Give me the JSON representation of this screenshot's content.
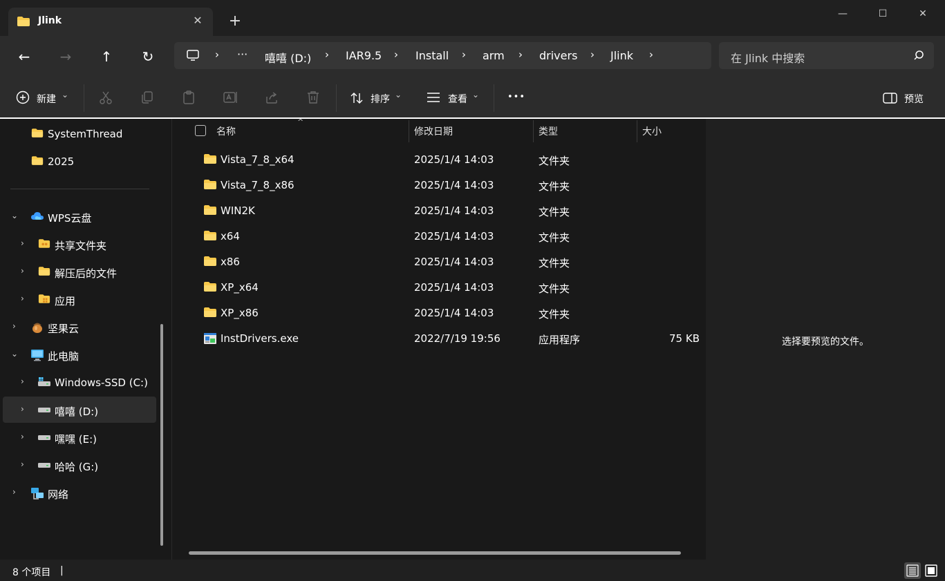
{
  "tab": {
    "title": "Jlink",
    "close": "✕"
  },
  "window": {
    "new_tab": "+",
    "minimize": "—",
    "maximize": "☐",
    "close": "✕"
  },
  "nav": {
    "back": "←",
    "forward": "→",
    "up": "↑",
    "refresh": "↻"
  },
  "breadcrumb": {
    "more": "···",
    "items": [
      "嘻嘻 (D:)",
      "IAR9.5",
      "Install",
      "arm",
      "drivers",
      "Jlink"
    ],
    "chevron": "›"
  },
  "search": {
    "placeholder": "在 Jlink 中搜索"
  },
  "toolbar": {
    "new_label": "新建",
    "sort_label": "排序",
    "view_label": "查看",
    "more_label": "•••",
    "preview_label": "预览",
    "dropdown": "⌄"
  },
  "sidebar": {
    "items": [
      {
        "label": "SystemThread",
        "icon": "folder-icon"
      },
      {
        "label": "2025",
        "icon": "folder-icon"
      },
      {
        "label": "WPS云盘",
        "icon": "cloud-icon"
      },
      {
        "label": "共享文件夹",
        "icon": "shared-folder-icon"
      },
      {
        "label": "解压后的文件",
        "icon": "folder-icon"
      },
      {
        "label": "应用",
        "icon": "app-folder-icon"
      },
      {
        "label": "坚果云",
        "icon": "nut-icon"
      },
      {
        "label": "此电脑",
        "icon": "pc-icon"
      },
      {
        "label": "Windows-SSD (C:)",
        "icon": "system-drive-icon"
      },
      {
        "label": "嘻嘻 (D:)",
        "icon": "drive-icon"
      },
      {
        "label": "嘿嘿 (E:)",
        "icon": "drive-icon"
      },
      {
        "label": "哈哈 (G:)",
        "icon": "drive-icon"
      },
      {
        "label": "网络",
        "icon": "network-icon"
      }
    ],
    "expand": "›",
    "collapse": "⌄"
  },
  "columns": {
    "name": "名称",
    "modified": "修改日期",
    "type": "类型",
    "size": "大小"
  },
  "files": [
    {
      "name": "Vista_7_8_x64",
      "modified": "2025/1/4 14:03",
      "type": "文件夹",
      "size": ""
    },
    {
      "name": "Vista_7_8_x86",
      "modified": "2025/1/4 14:03",
      "type": "文件夹",
      "size": ""
    },
    {
      "name": "WIN2K",
      "modified": "2025/1/4 14:03",
      "type": "文件夹",
      "size": ""
    },
    {
      "name": "x64",
      "modified": "2025/1/4 14:03",
      "type": "文件夹",
      "size": ""
    },
    {
      "name": "x86",
      "modified": "2025/1/4 14:03",
      "type": "文件夹",
      "size": ""
    },
    {
      "name": "XP_x64",
      "modified": "2025/1/4 14:03",
      "type": "文件夹",
      "size": ""
    },
    {
      "name": "XP_x86",
      "modified": "2025/1/4 14:03",
      "type": "文件夹",
      "size": ""
    },
    {
      "name": "InstDrivers.exe",
      "modified": "2022/7/19 19:56",
      "type": "应用程序",
      "size": "75 KB"
    }
  ],
  "preview": {
    "message": "选择要预览的文件。"
  },
  "status": {
    "count": "8 个项目",
    "bar": "|"
  },
  "colors": {
    "accent": "#4cc2ff",
    "folder": "#f8c94a",
    "background": "#191919",
    "chrome": "#2c2c2c"
  }
}
